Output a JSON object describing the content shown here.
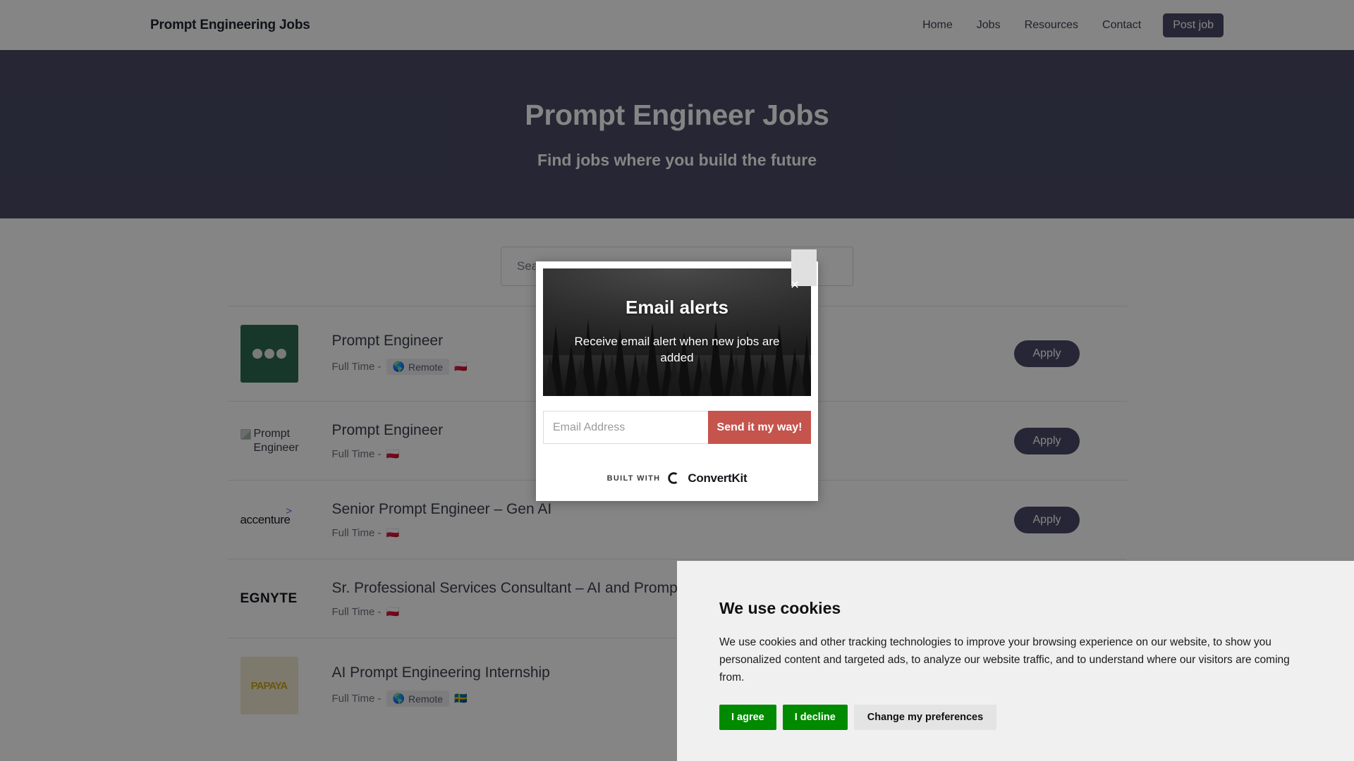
{
  "nav": {
    "brand": "Prompt Engineering Jobs",
    "links": [
      {
        "label": "Home"
      },
      {
        "label": "Jobs"
      },
      {
        "label": "Resources"
      },
      {
        "label": "Contact"
      }
    ],
    "post_job_label": "Post job"
  },
  "hero": {
    "title": "Prompt Engineer Jobs",
    "subtitle": "Find jobs where you build the future"
  },
  "search": {
    "placeholder": "Search Jobs"
  },
  "jobs": {
    "apply_label": "Apply",
    "items": [
      {
        "title": "Prompt Engineer",
        "type": "Full Time -",
        "remote": "Remote",
        "flag": "🇵🇱",
        "logo_kind": "green-dots",
        "logo_text": ""
      },
      {
        "title": "Prompt Engineer",
        "type": "Full Time -",
        "remote": "",
        "flag": "🇵🇱",
        "logo_kind": "broken-image",
        "logo_text": "Prompt Engineer"
      },
      {
        "title": "Senior Prompt Engineer – Gen AI",
        "type": "Full Time -",
        "remote": "",
        "flag": "🇵🇱",
        "logo_kind": "accenture",
        "logo_text": "accenture"
      },
      {
        "title": "Sr. Professional Services Consultant – AI and Prompt Engineering",
        "type": "Full Time -",
        "remote": "",
        "flag": "🇵🇱",
        "logo_kind": "egnyte",
        "logo_text": "EGNYTE"
      },
      {
        "title": "AI Prompt Engineering Internship",
        "type": "Full Time -",
        "remote": "Remote",
        "flag": "🇸🇪",
        "logo_kind": "yellow-wordmark",
        "logo_text": "PAPAYA"
      }
    ]
  },
  "modal": {
    "title": "Email alerts",
    "subtitle": "Receive email alert when new jobs are added",
    "email_placeholder": "Email Address",
    "submit_label": "Send it my way!",
    "built_with_label": "BUILT WITH",
    "provider": "ConvertKit",
    "close_icon": "×",
    "accent_color": "#c5544c"
  },
  "cookies": {
    "title": "We use cookies",
    "body": "We use cookies and other tracking technologies to improve your browsing experience on our website, to show you personalized content and targeted ads, to analyze our website traffic, and to understand where our visitors are coming from.",
    "agree_label": "I agree",
    "decline_label": "I decline",
    "prefs_label": "Change my preferences",
    "agree_color": "#008a00"
  }
}
